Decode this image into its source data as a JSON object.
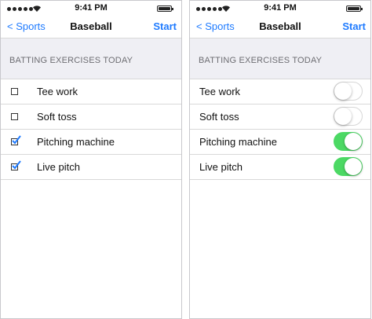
{
  "colors": {
    "accent": "#1f7bff",
    "toggle_on": "#4cd964",
    "section_bg": "#efeff4"
  },
  "status_bar": {
    "time": "9:41 PM"
  },
  "nav": {
    "back_label": "< Sports",
    "title": "Baseball",
    "start_label": "Start"
  },
  "section": {
    "title": "BATTING EXERCISES TODAY"
  },
  "exercises": [
    {
      "label": "Tee work",
      "checked": false
    },
    {
      "label": "Soft toss",
      "checked": false
    },
    {
      "label": "Pitching machine",
      "checked": true
    },
    {
      "label": "Live pitch",
      "checked": true
    }
  ]
}
